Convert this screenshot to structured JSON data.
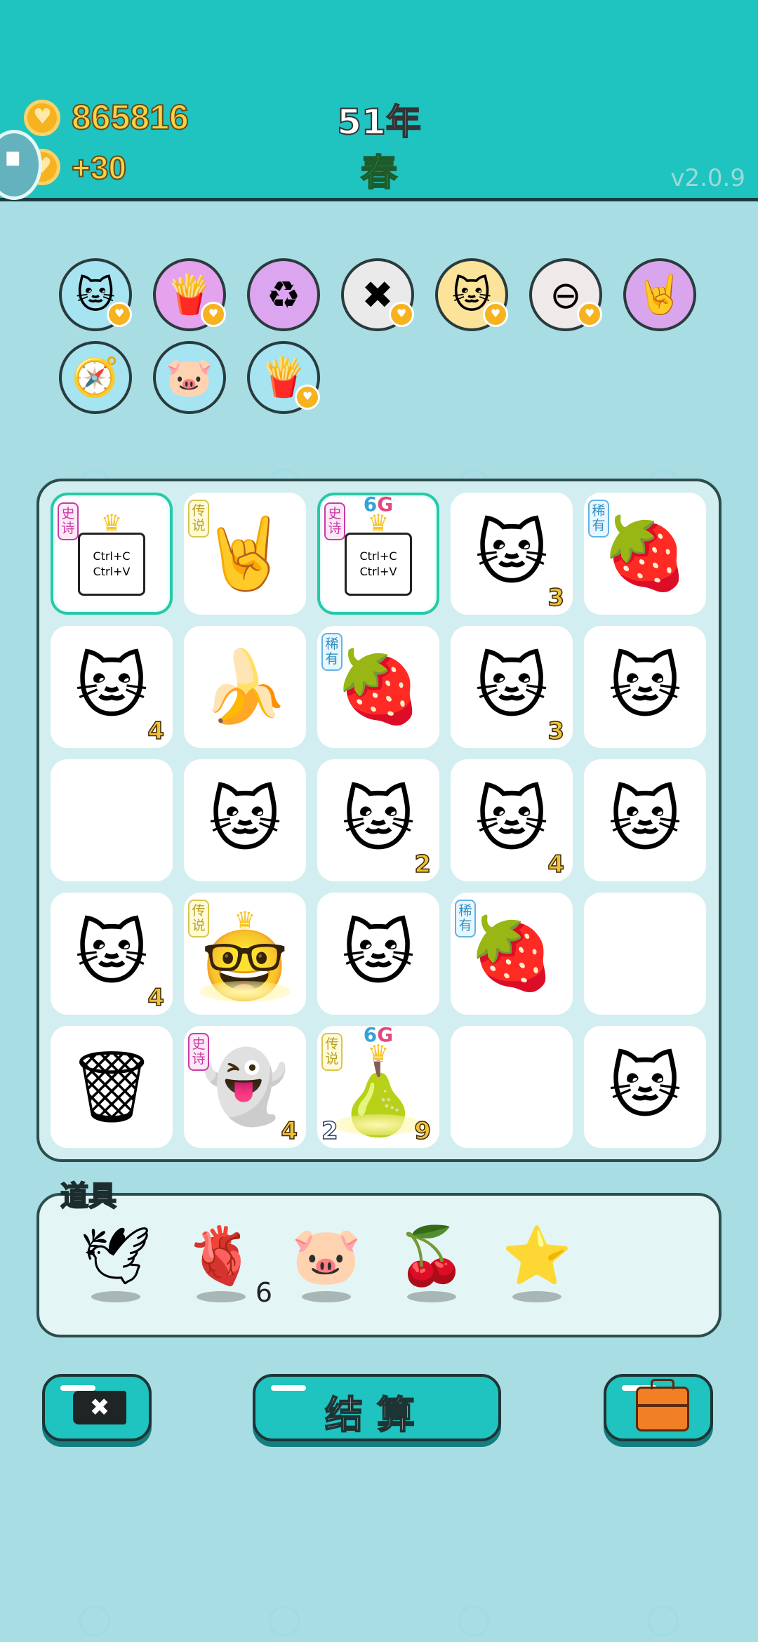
{
  "header": {
    "coins": "865816",
    "income": "+30",
    "year": "51年",
    "season": "春",
    "version": "v2.0.9"
  },
  "relics": [
    {
      "name": "cat-sunglasses-relic",
      "icon": "🐱",
      "bg": "#a6e4f2",
      "heart": true
    },
    {
      "name": "fries-relic",
      "icon": "🍟",
      "bg": "#e5a3ee",
      "heart": true
    },
    {
      "name": "recycle-relic",
      "icon": "♻",
      "bg": "#dca5f0",
      "heart": false
    },
    {
      "name": "remove-tag-relic",
      "icon": "✖",
      "bg": "#eaeaea",
      "heart": true
    },
    {
      "name": "twin-cats-relic",
      "icon": "🐱",
      "bg": "#fbe399",
      "heart": true
    },
    {
      "name": "minus-relic",
      "icon": "⊖",
      "bg": "#efe9e9",
      "heart": true
    },
    {
      "name": "rock-hand-relic",
      "icon": "🤘",
      "bg": "#d9a6ee",
      "heart": false
    },
    {
      "name": "compass-relic",
      "icon": "🧭",
      "bg": "#a6e4f2",
      "heart": false
    },
    {
      "name": "piggy-bank-relic",
      "icon": "🐷",
      "bg": "#a6e4f2",
      "heart": false
    },
    {
      "name": "fries-relic-2",
      "icon": "🍟",
      "bg": "#a6e4f2",
      "heart": true
    }
  ],
  "tags": {
    "epic": "史诗",
    "legend": "传说",
    "rare": "稀有"
  },
  "ctrl": {
    "line1": "Ctrl+C",
    "line2": "Ctrl+V"
  },
  "sixg": {
    "six": "6",
    "g": "G"
  },
  "grid": [
    {
      "icon": "ctrl",
      "tag": "epic",
      "crown": true,
      "hl": true,
      "num": "",
      "numL": "",
      "sixg": false
    },
    {
      "icon": "🤘",
      "tag": "legend",
      "num": "",
      "numL": ""
    },
    {
      "icon": "ctrl",
      "tag": "epic",
      "crown": true,
      "hl": true,
      "num": "",
      "numL": "",
      "sixg": true
    },
    {
      "icon": "🐱",
      "num": "3"
    },
    {
      "icon": "🍓",
      "tag": "rare",
      "num": ""
    },
    {
      "icon": "🐱",
      "num": "4"
    },
    {
      "icon": "🍌",
      "num": ""
    },
    {
      "icon": "🍓",
      "tag": "rare",
      "num": ""
    },
    {
      "icon": "🐱",
      "num": "3"
    },
    {
      "icon": "🐱",
      "num": ""
    },
    {
      "icon": "",
      "num": ""
    },
    {
      "icon": "🐱",
      "num": ""
    },
    {
      "icon": "🐱",
      "num": "2"
    },
    {
      "icon": "🐱",
      "num": "4"
    },
    {
      "icon": "🐱",
      "num": ""
    },
    {
      "icon": "🐱",
      "num": "4"
    },
    {
      "icon": "🤓",
      "tag": "legend",
      "crown": true,
      "num": "",
      "glow": true
    },
    {
      "icon": "🐱",
      "num": ""
    },
    {
      "icon": "🍓",
      "tag": "rare",
      "num": ""
    },
    {
      "icon": "",
      "num": ""
    },
    {
      "icon": "🗑",
      "num": ""
    },
    {
      "icon": "👻",
      "tag": "epic",
      "num": "4"
    },
    {
      "icon": "🍐",
      "tag": "legend",
      "crown": true,
      "sixg": true,
      "glow": true,
      "num": "9",
      "numL": "2"
    },
    {
      "icon": "",
      "num": ""
    },
    {
      "icon": "🐱",
      "num": ""
    }
  ],
  "items": {
    "label": "道具",
    "list": [
      {
        "name": "dove-item",
        "icon": "🕊",
        "count": ""
      },
      {
        "name": "liver-item",
        "icon": "🫀",
        "count": "6"
      },
      {
        "name": "piggy-item",
        "icon": "🐷",
        "count": ""
      },
      {
        "name": "bayberry-item",
        "icon": "🍒",
        "count": ""
      },
      {
        "name": "star-item",
        "icon": "⭐",
        "count": ""
      }
    ]
  },
  "buttons": {
    "remove": "✖",
    "settle": "结算"
  }
}
